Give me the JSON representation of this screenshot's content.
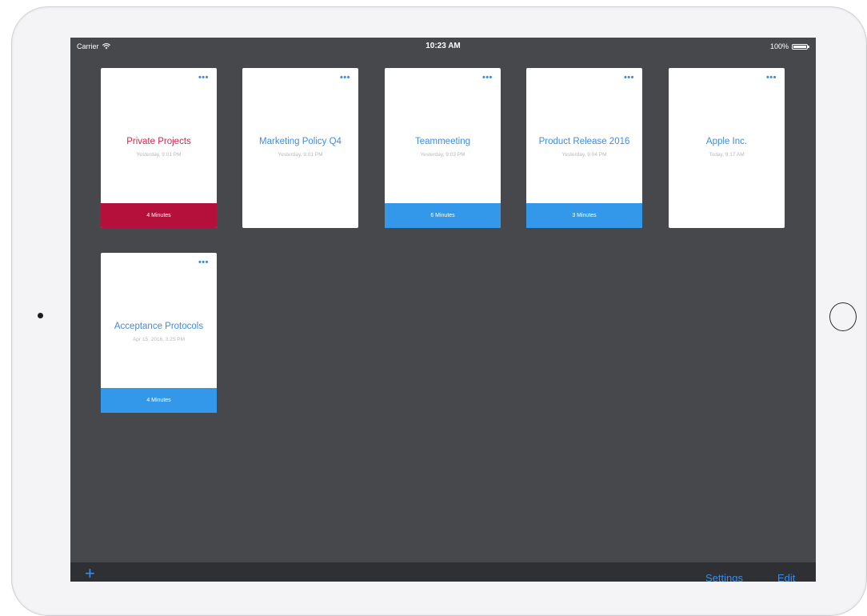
{
  "status_bar": {
    "carrier": "Carrier",
    "time": "10:23 AM",
    "battery": "100%"
  },
  "colors": {
    "screen_bg": "#47484b",
    "accent_blue": "#3d8be8",
    "footer_blue": "#3398ea",
    "footer_red": "#b5103c",
    "title_red": "#d6264e",
    "title_blue": "#3d8be8"
  },
  "cards": [
    {
      "title": "Private Projects",
      "date": "Yesterday, 9:01 PM",
      "footer": "4 Minutes",
      "more": "•••"
    },
    {
      "title": "Marketing Policy Q4",
      "date": "Yesterday, 9:01 PM",
      "footer": "",
      "more": "•••"
    },
    {
      "title": "Teammeeting",
      "date": "Yesterday, 9:03 PM",
      "footer": "6 Minutes",
      "more": "•••"
    },
    {
      "title": "Product Release 2016",
      "date": "Yesterday, 9:04 PM",
      "footer": "3 Minutes",
      "more": "•••"
    },
    {
      "title": "Apple Inc.",
      "date": "Today, 9:17 AM",
      "footer": "",
      "more": "•••"
    },
    {
      "title": "Acceptance Protocols",
      "date": "Apr 15, 2016, 3:25 PM",
      "footer": "4 Minutes",
      "more": "•••"
    }
  ],
  "toolbar": {
    "add_label": "+",
    "settings_label": "Settings",
    "edit_label": "Edit"
  }
}
